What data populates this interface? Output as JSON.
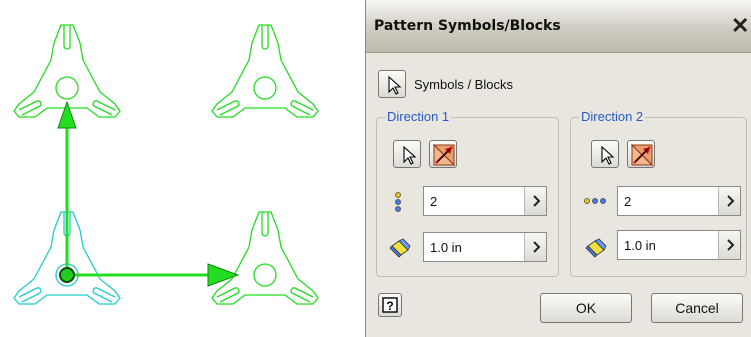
{
  "dialog": {
    "title": "Pattern Symbols/Blocks",
    "close_icon": "close-x-icon",
    "symbols_label": "Symbols / Blocks",
    "direction1": {
      "title": "Direction 1",
      "count": "2",
      "spacing": "1.0 in",
      "count_icon": "vertical-dots-icon",
      "spacing_icon": "spacing-eraser-icon"
    },
    "direction2": {
      "title": "Direction 2",
      "count": "2",
      "spacing": "1.0 in",
      "count_icon": "horizontal-dots-icon",
      "spacing_icon": "spacing-eraser-icon"
    },
    "ok_label": "OK",
    "cancel_label": "Cancel",
    "help_icon": "help-question-icon"
  },
  "canvas": {
    "symbol_color": "#22dd22",
    "selected_symbol_color": "#22cccc",
    "arrow_color": "#22dd22"
  }
}
